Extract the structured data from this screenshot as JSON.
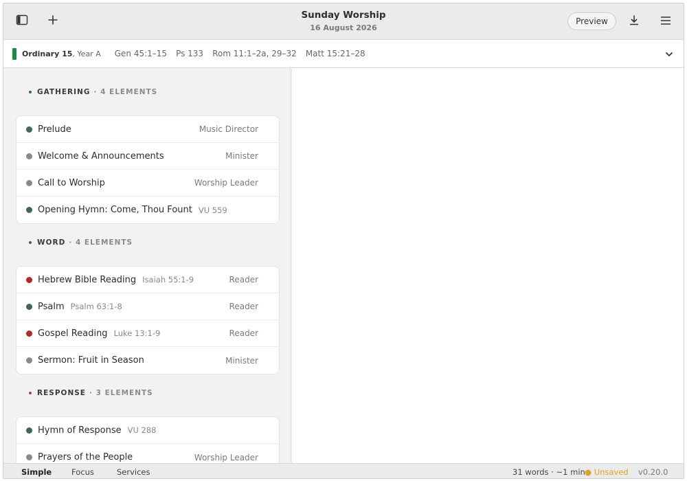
{
  "header": {
    "title": "Sunday Worship",
    "subtitle": "16 August 2026",
    "preview_label": "Preview",
    "icons": [
      "sidebar-toggle-icon",
      "plus-icon",
      "download-icon",
      "menu-icon"
    ]
  },
  "lectionary": {
    "color": "#1e8a46",
    "sunday": "Ordinary 15",
    "year": ", Year A",
    "readings": [
      "Gen 45:1–15",
      "Ps 133",
      "Rom 11:1–2a, 29–32",
      "Matt 15:21–28"
    ]
  },
  "sections": [
    {
      "name": "GATHERING",
      "count": "· 4 ELEMENTS",
      "dot_color": "#2f6b47",
      "items": [
        {
          "title": "Prelude",
          "ref": "",
          "role": "Music Director",
          "dot": "#3e6a52"
        },
        {
          "title": "Welcome & Announcements",
          "ref": "",
          "role": "Minister",
          "dot": "#8b8b85"
        },
        {
          "title": "Call to Worship",
          "ref": "",
          "role": "Worship Leader",
          "dot": "#8b8b85"
        },
        {
          "title": "Opening Hymn: Come, Thou Fount",
          "ref": "VU 559",
          "role": "",
          "dot": "#3e6a52"
        }
      ]
    },
    {
      "name": "WORD",
      "count": "· 4 ELEMENTS",
      "dot_color": "#3c5a8a",
      "items": [
        {
          "title": "Hebrew Bible Reading",
          "ref": "Isaiah 55:1-9",
          "role": "Reader",
          "dot": "#b22a25"
        },
        {
          "title": "Psalm",
          "ref": "Psalm 63:1-8",
          "role": "Reader",
          "dot": "#3e6a52"
        },
        {
          "title": "Gospel Reading",
          "ref": "Luke 13:1-9",
          "role": "Reader",
          "dot": "#b22a25"
        },
        {
          "title": "Sermon: Fruit in Season",
          "ref": "",
          "role": "Minister",
          "dot": "#8b8b85"
        }
      ]
    },
    {
      "name": "RESPONSE",
      "count": "· 3 ELEMENTS",
      "dot_color": "#9b4a3a",
      "items": [
        {
          "title": "Hymn of Response",
          "ref": "VU 288",
          "role": "",
          "dot": "#3e6a52"
        },
        {
          "title": "Prayers of the People",
          "ref": "",
          "role": "Worship Leader",
          "dot": "#8b8b85"
        }
      ]
    }
  ],
  "status": {
    "modes": [
      "Simple",
      "Focus",
      "Services"
    ],
    "active_mode": "Simple",
    "word_count": "31 words · ~1 min",
    "unsaved": "● Unsaved",
    "version": "v0.20.0"
  }
}
